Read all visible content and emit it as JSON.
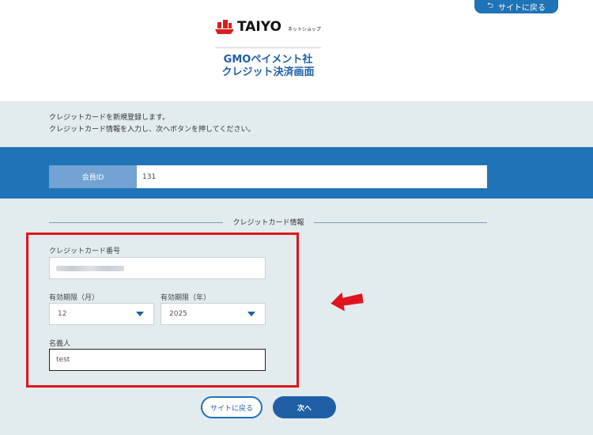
{
  "header": {
    "back_link": "サイトに戻る",
    "logo_text": "TAIYO",
    "logo_sub": "ネットショップ",
    "title_line1": "GMOペイメント社",
    "title_line2": "クレジット決済画面"
  },
  "intro": {
    "line1": "クレジットカードを新規登録します。",
    "line2": "クレジットカード情報を入力し、次へボタンを押してください。"
  },
  "member": {
    "label": "会員ID",
    "value": "131"
  },
  "section_title": "クレジットカード情報",
  "form": {
    "card_number_label": "クレジットカード番号",
    "exp_month_label": "有効期限（月）",
    "exp_month_value": "12",
    "exp_year_label": "有効期限（年）",
    "exp_year_value": "2025",
    "holder_label": "名義人",
    "holder_value": "test"
  },
  "buttons": {
    "back": "サイトに戻る",
    "next": "次へ"
  },
  "colors": {
    "accent": "#1f73b7",
    "highlight": "#e0141e"
  }
}
